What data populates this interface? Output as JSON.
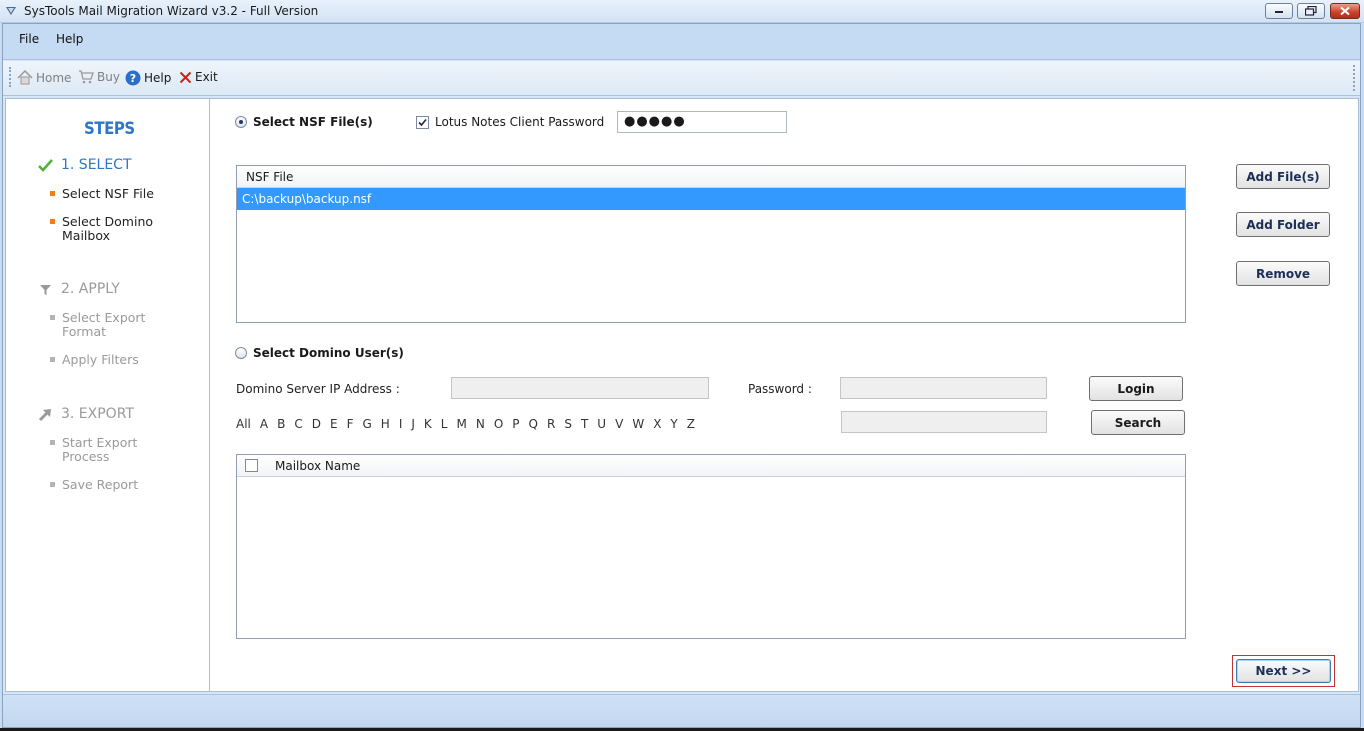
{
  "window": {
    "title": "SysTools Mail Migration Wizard v3.2 - Full Version"
  },
  "menu": {
    "file": "File",
    "help": "Help"
  },
  "toolbar": {
    "home": "Home",
    "buy": "Buy",
    "help": "Help",
    "exit": "Exit"
  },
  "steps": {
    "title": "STEPS",
    "step1": {
      "label": "1. SELECT",
      "items": [
        "Select NSF File",
        "Select Domino\nMailbox"
      ]
    },
    "step2": {
      "label": "2. APPLY",
      "items": [
        "Select Export\nFormat",
        "Apply Filters"
      ]
    },
    "step3": {
      "label": "3. EXPORT",
      "items": [
        "Start Export\nProcess",
        "Save Report"
      ]
    }
  },
  "nsf": {
    "radio_label": "Select NSF File(s)",
    "password_checkbox_label": "Lotus Notes Client Password",
    "password_value": "●●●●●",
    "column_header": "NSF File",
    "rows": [
      "C:\\backup\\backup.nsf"
    ],
    "add_files": "Add File(s)",
    "add_folder": "Add Folder",
    "remove": "Remove"
  },
  "domino": {
    "radio_label": "Select Domino User(s)",
    "server_ip_label": "Domino Server IP Address :",
    "password_label": "Password :",
    "login": "Login",
    "search": "Search",
    "alphabet": [
      "All",
      "A",
      "B",
      "C",
      "D",
      "E",
      "F",
      "G",
      "H",
      "I",
      "J",
      "K",
      "L",
      "M",
      "N",
      "O",
      "P",
      "Q",
      "R",
      "S",
      "T",
      "U",
      "V",
      "W",
      "X",
      "Y",
      "Z"
    ],
    "mailbox_column": "Mailbox Name"
  },
  "footer": {
    "next": "Next >>"
  },
  "colors": {
    "accent": "#2f75c8",
    "bullet_active": "#f07d1a",
    "selection": "#3399ff"
  }
}
